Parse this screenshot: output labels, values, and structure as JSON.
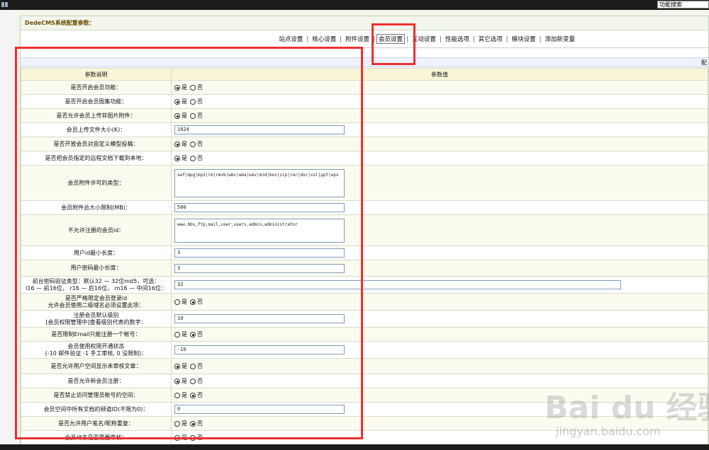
{
  "search_box": "功能搜索",
  "panel_title": "DedeCMS系统配置参数：",
  "tabs": [
    "站点设置",
    "核心设置",
    "附件设置",
    "会员设置",
    "互动设置",
    "性能选项",
    "其它选项",
    "模块设置",
    "添加新变量"
  ],
  "active_tab": 3,
  "infobar_text": "配",
  "headers": {
    "label": "参数说明",
    "value": "参数值"
  },
  "radio": {
    "yes": "是",
    "no": "否"
  },
  "rows": [
    {
      "label": "是否开启会员功能：",
      "type": "radio",
      "selected": "yes"
    },
    {
      "label": "是否开启会员图集功能：",
      "type": "radio",
      "selected": "yes"
    },
    {
      "label": "是否允许会员上传非图片附件：",
      "type": "radio",
      "selected": "yes"
    },
    {
      "label": "会员上传文件大小(K)：",
      "type": "text",
      "value": "1024"
    },
    {
      "label": "是否开放会员对自定义模型投稿：",
      "type": "radio",
      "selected": "yes"
    },
    {
      "label": "是否把会员指定的远程文档下载到本地：",
      "type": "radio",
      "selected": "yes"
    },
    {
      "label": "会员附件许可的类型：",
      "type": "textarea",
      "value": "swf|mpg|mp3|rm|rmvb|wmv|wma|wav|mid|mov|zip|rar|doc|xsl|ppt|wps"
    },
    {
      "label": "会员附件总大小限制(MB)：",
      "type": "text",
      "value": "500"
    },
    {
      "label": "不允许注册的会员id：",
      "type": "textarea",
      "value": "www,bbs,ftp,mail,user,users,admin,administrator"
    },
    {
      "label": "用户id最小长度：",
      "type": "text",
      "value": "3"
    },
    {
      "label": "用户密码最小长度：",
      "type": "text",
      "value": "3"
    },
    {
      "label": "前台密码验证类型：默认32 — 32位md5，可选：\nl16 — 前16位， r16 — 后16位， m16 — 中间16位：",
      "type": "text-wide",
      "value": "32"
    },
    {
      "label": "是否严格限定会员登录id\n允许会员使用二级域名必须设置此项：",
      "type": "radio",
      "selected": "no"
    },
    {
      "label": "注册会员默认级别\n[会员权限管理中]查看级别代表的数字：",
      "type": "text",
      "value": "10"
    },
    {
      "label": "是否限制Email只能注册一个帐号：",
      "type": "radio",
      "selected": "no"
    },
    {
      "label": "会员使用权限开通状态\n(-10 邮件验证 -1 手工审核, 0 没限制)：",
      "type": "text",
      "value": "-10"
    },
    {
      "label": "是否允许用户空间显示未审核文章：",
      "type": "radio",
      "selected": "yes"
    },
    {
      "label": "是否允许新会员注册：",
      "type": "radio",
      "selected": "yes"
    },
    {
      "label": "是否禁止访问管理员帐号的空间：",
      "type": "radio",
      "selected": "no"
    },
    {
      "label": "会员空间中所有文档的频道ID(不限为0)：",
      "type": "text",
      "value": "0"
    },
    {
      "label": "是否允许用户笔名/昵称重复：",
      "type": "radio",
      "selected": "no"
    },
    {
      "label": "会员动态是否需要审核：",
      "type": "radio",
      "selected": "no"
    }
  ],
  "watermark": {
    "main": "Bai du 经验",
    "sub": "jingyan.baidu.com"
  }
}
